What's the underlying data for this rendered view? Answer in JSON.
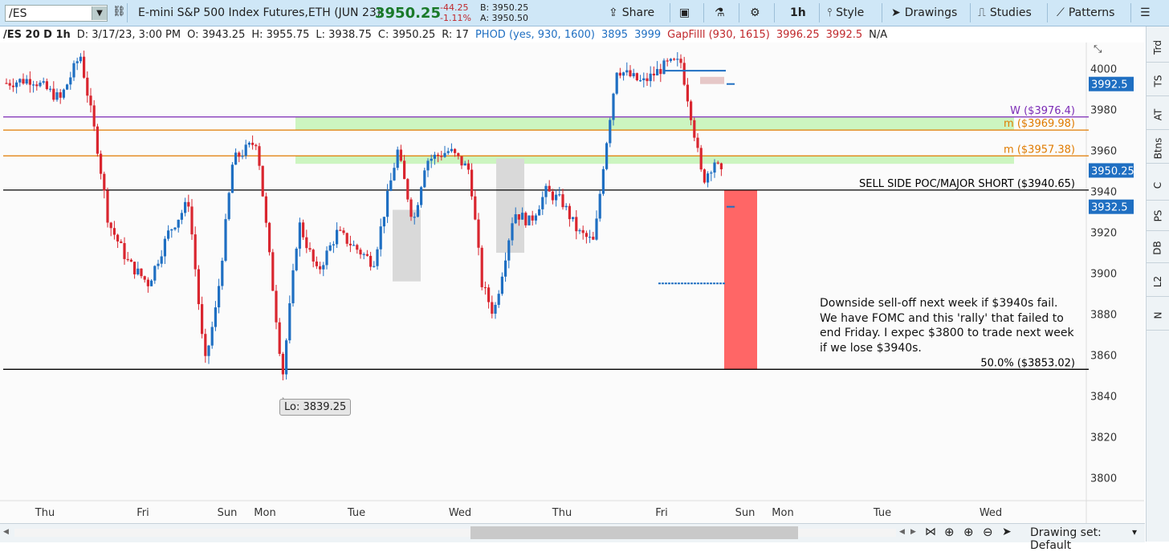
{
  "toolbar": {
    "symbol": "/ES",
    "description": "E-mini S&P 500 Index Futures,ETH (JUN 23)",
    "last": "3950.25",
    "net_change": "-44.25",
    "pct_change": "-1.11%",
    "bid": "B: 3950.25",
    "ask": "A: 3950.50",
    "share": "Share",
    "timeframe": "1h",
    "style": "Style",
    "drawings": "Drawings",
    "studies": "Studies",
    "patterns": "Patterns"
  },
  "infobar": {
    "label": "/ES 20 D 1h",
    "date": "D: 3/17/23, 3:00 PM",
    "open": "O: 3943.25",
    "high": "H: 3955.75",
    "low": "L: 3938.75",
    "close": "C: 3950.25",
    "range": "R: 17",
    "phod": "PHOD (yes, 930, 1600)",
    "phod_v1": "3895",
    "phod_v2": "3999",
    "gapfill": "GapFilll (930, 1615)",
    "gap_v1": "3996.25",
    "gap_v2": "3992.5",
    "na": "N/A"
  },
  "chart_data": {
    "type": "candlestick",
    "timeframe": "1h",
    "days_shown": "20 D",
    "ylim": [
      3790,
      4012
    ],
    "y_ticks": [
      3800,
      3820,
      3840,
      3860,
      3880,
      3900,
      3920,
      3940,
      3960,
      3980,
      4000
    ],
    "x_labels": [
      "Thu",
      "Fri",
      "Sun",
      "Mon",
      "Tue",
      "Wed",
      "Thu",
      "Fri",
      "Sun",
      "Mon",
      "Tue",
      "Wed"
    ],
    "price_labels": [
      {
        "value": "3992.5",
        "color": "#1f6fc2"
      },
      {
        "value": "3950.25",
        "color": "#1f6fc2"
      },
      {
        "value": "3932.5",
        "color": "#1f6fc2"
      }
    ],
    "levels": [
      {
        "label": "W ($3976.4)",
        "price": 3976.4,
        "color": "#7b2ab5"
      },
      {
        "label": "m ($3969.98)",
        "price": 3969.98,
        "color": "#e07b00"
      },
      {
        "label": "m ($3957.38)",
        "price": 3957.38,
        "color": "#e07b00"
      },
      {
        "label": "SELL SIDE POC/MAJOR SHORT  ($3940.65)",
        "price": 3940.65,
        "color": "#000000"
      },
      {
        "label": "50.0%  ($3853.02)",
        "price": 3853.02,
        "color": "#000000"
      }
    ],
    "low_label": "Lo: 3839.25",
    "low_price": 3839.25,
    "zones": [
      {
        "price_from": 3969.98,
        "price_to": 3976.4,
        "color": "#ccf5c0"
      },
      {
        "price_from": 3953.5,
        "price_to": 3957.38,
        "color": "#ccf5c0"
      }
    ],
    "target_box": {
      "price_from": 3853.02,
      "price_to": 3940.65,
      "color": "#ff6666"
    }
  },
  "note": {
    "line1": "Downside sell-off next week if $3940s fail.",
    "line2": "We have FOMC and this 'rally' that failed to",
    "line3": "end Friday. I expec $3800 to trade next week",
    "line4": "if we lose $3940s."
  },
  "right_tabs": [
    "Trd",
    "TS",
    "AT",
    "Btns",
    "C",
    "PS",
    "DB",
    "L2",
    "N"
  ],
  "bottom": {
    "drawing_set": "Drawing set: Default"
  },
  "colors": {
    "up": "#1f6fc2",
    "down": "#d9262f",
    "toolbar_bg": "#cfe7f7",
    "last_price": "#1a7a2a"
  }
}
